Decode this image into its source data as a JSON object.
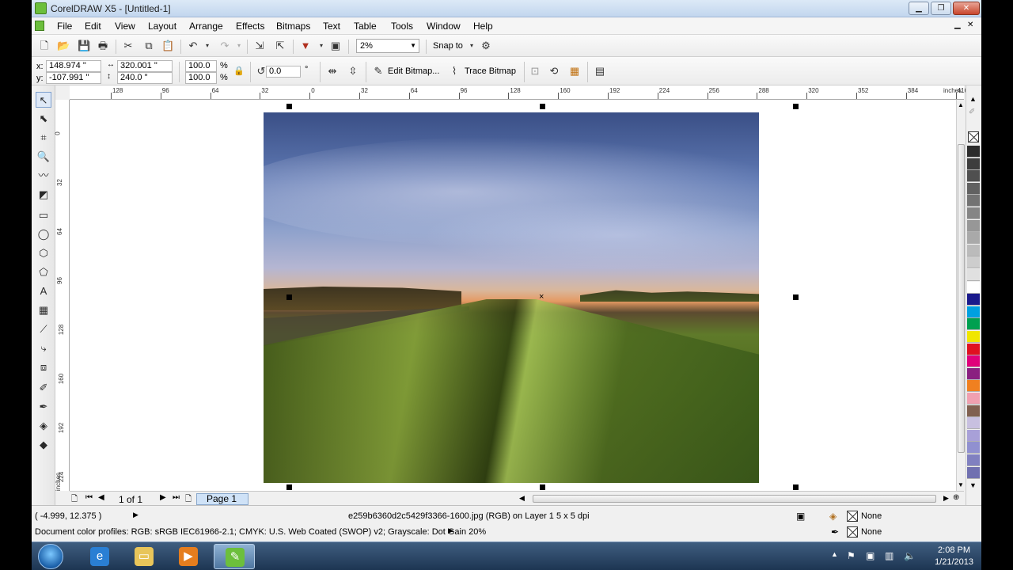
{
  "window": {
    "title": "CorelDRAW X5 - [Untitled-1]"
  },
  "menu": [
    "File",
    "Edit",
    "View",
    "Layout",
    "Arrange",
    "Effects",
    "Bitmaps",
    "Text",
    "Table",
    "Tools",
    "Window",
    "Help"
  ],
  "toolbar": {
    "zoom": "2%",
    "snap_to": "Snap to"
  },
  "property_bar": {
    "x_label": "x:",
    "x": "148.974 \"",
    "y_label": "y:",
    "y": "-107.991 \"",
    "width": "320.001 \"",
    "height": "240.0 \"",
    "scale_w": "100.0",
    "scale_h": "100.0",
    "percent": "%",
    "angle": "0.0",
    "degree": "°",
    "edit_bitmap": "Edit Bitmap...",
    "trace_bitmap": "Trace Bitmap"
  },
  "ruler": {
    "top_ticks": [
      "128",
      "96",
      "64",
      "32",
      "0",
      "32",
      "64",
      "96",
      "128",
      "160",
      "192",
      "224",
      "256",
      "288",
      "320",
      "352",
      "384",
      "416"
    ],
    "unit": "inches",
    "left_ticks": [
      "0",
      "32",
      "64",
      "96",
      "128",
      "160",
      "192",
      "224"
    ],
    "left_unit": "inches"
  },
  "pages": {
    "counter": "1 of 1",
    "tab": "Page 1"
  },
  "status": {
    "coords": "( -4.999, 12.375 )",
    "object_info": "e259b6360d2c5429f3366-1600.jpg (RGB) on Layer 1 5 x 5 dpi",
    "color_profiles": "Document color profiles: RGB: sRGB IEC61966-2.1; CMYK: U.S. Web Coated (SWOP) v2; Grayscale: Dot Gain 20%",
    "fill": "None",
    "outline": "None"
  },
  "palette_colors": [
    "#2b2b2b",
    "#3d3d3d",
    "#4f4f4f",
    "#616161",
    "#737373",
    "#858585",
    "#979797",
    "#a9a9a9",
    "#bbbbbb",
    "#cdcdcd",
    "#e0e0e0",
    "#ffffff",
    "#1a1a8c",
    "#00a0e0",
    "#00a050",
    "#f0e600",
    "#e01020",
    "#e0007a",
    "#8a2080",
    "#f08020",
    "#f0a0b0",
    "#806050",
    "#c8c0e0",
    "#a8a0d8",
    "#9090d0",
    "#8080c0",
    "#7070b0"
  ],
  "taskbar": {
    "time": "2:08 PM",
    "date": "1/21/2013"
  }
}
